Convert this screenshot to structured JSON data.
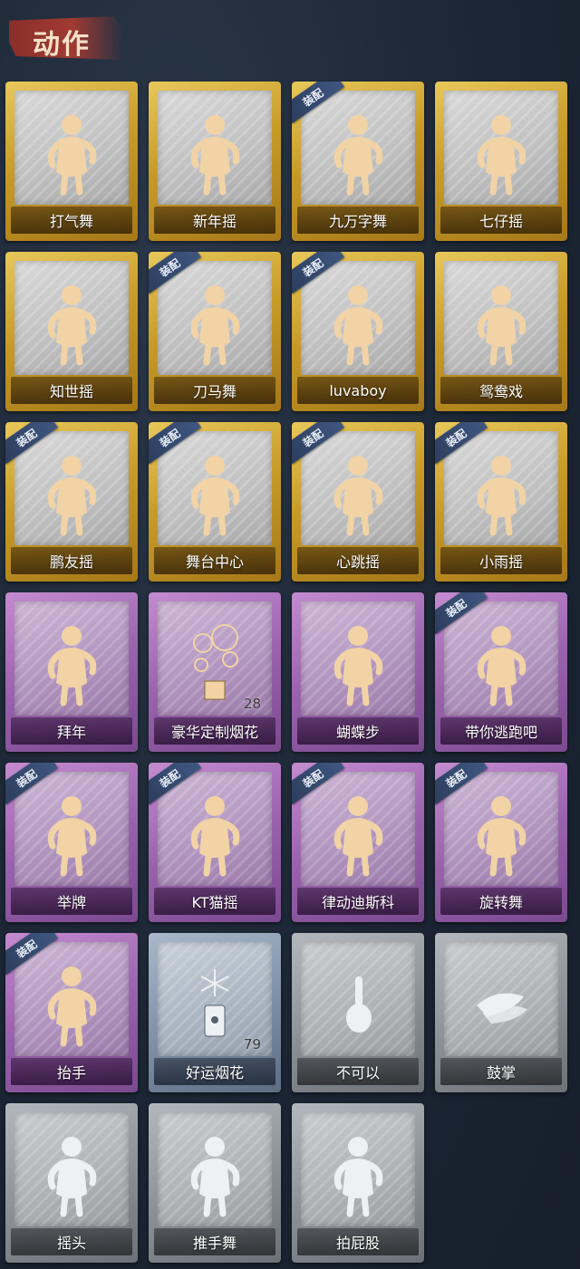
{
  "section_title": "动作",
  "badge_text": "装配",
  "colors": {
    "gold": "#c89b28",
    "purple": "#9a62ad",
    "blue": "#7d8ea5",
    "gray": "#8a8f96",
    "badge": "#33486d",
    "figure_gold": "#f1d3a6",
    "figure_white": "#eef0f4"
  },
  "cards": [
    {
      "label": "打气舞",
      "rarity": "gold",
      "equipped": false,
      "icon": "figure-dance-icon"
    },
    {
      "label": "新年摇",
      "rarity": "gold",
      "equipped": false,
      "icon": "figure-dance-icon"
    },
    {
      "label": "九万字舞",
      "rarity": "gold",
      "equipped": true,
      "icon": "figure-dance-icon"
    },
    {
      "label": "七仔摇",
      "rarity": "gold",
      "equipped": false,
      "icon": "figure-dance-icon"
    },
    {
      "label": "知世摇",
      "rarity": "gold",
      "equipped": false,
      "icon": "figure-dance-icon"
    },
    {
      "label": "刀马舞",
      "rarity": "gold",
      "equipped": true,
      "icon": "figure-dance-icon"
    },
    {
      "label": "luvaboy",
      "rarity": "gold",
      "equipped": true,
      "icon": "figure-dance-icon"
    },
    {
      "label": "鸳鸯戏",
      "rarity": "gold",
      "equipped": false,
      "icon": "figure-dance-icon"
    },
    {
      "label": "鹏友摇",
      "rarity": "gold",
      "equipped": true,
      "icon": "figure-dance-icon"
    },
    {
      "label": "舞台中心",
      "rarity": "gold",
      "equipped": true,
      "icon": "figure-dance-icon"
    },
    {
      "label": "心跳摇",
      "rarity": "gold",
      "equipped": true,
      "icon": "figure-dance-icon"
    },
    {
      "label": "小雨摇",
      "rarity": "gold",
      "equipped": true,
      "icon": "figure-dance-icon"
    },
    {
      "label": "拜年",
      "rarity": "purple",
      "equipped": false,
      "icon": "figure-bow-icon"
    },
    {
      "label": "豪华定制烟花",
      "rarity": "purple",
      "equipped": false,
      "icon": "firework-box-icon",
      "count": "28"
    },
    {
      "label": "蝴蝶步",
      "rarity": "purple",
      "equipped": false,
      "icon": "figure-dance-icon"
    },
    {
      "label": "带你逃跑吧",
      "rarity": "purple",
      "equipped": true,
      "icon": "figure-point-icon"
    },
    {
      "label": "举牌",
      "rarity": "purple",
      "equipped": true,
      "icon": "figure-sign-icon"
    },
    {
      "label": "KT猫摇",
      "rarity": "purple",
      "equipped": true,
      "icon": "figure-dance-icon"
    },
    {
      "label": "律动迪斯科",
      "rarity": "purple",
      "equipped": true,
      "icon": "figure-disco-icon"
    },
    {
      "label": "旋转舞",
      "rarity": "purple",
      "equipped": true,
      "icon": "figure-spin-icon"
    },
    {
      "label": "抬手",
      "rarity": "purple",
      "equipped": true,
      "icon": "figure-raise-hand-icon"
    },
    {
      "label": "好运烟花",
      "rarity": "blue",
      "equipped": false,
      "icon": "firework-can-icon",
      "count": "79"
    },
    {
      "label": "不可以",
      "rarity": "gray",
      "equipped": false,
      "icon": "finger-wag-icon"
    },
    {
      "label": "鼓掌",
      "rarity": "gray",
      "equipped": false,
      "icon": "clap-hands-icon"
    },
    {
      "label": "摇头",
      "rarity": "gray",
      "equipped": false,
      "icon": "figure-shake-head-icon"
    },
    {
      "label": "推手舞",
      "rarity": "gray",
      "equipped": false,
      "icon": "figure-push-icon"
    },
    {
      "label": "拍屁股",
      "rarity": "gray",
      "equipped": false,
      "icon": "figure-pat-icon"
    }
  ]
}
